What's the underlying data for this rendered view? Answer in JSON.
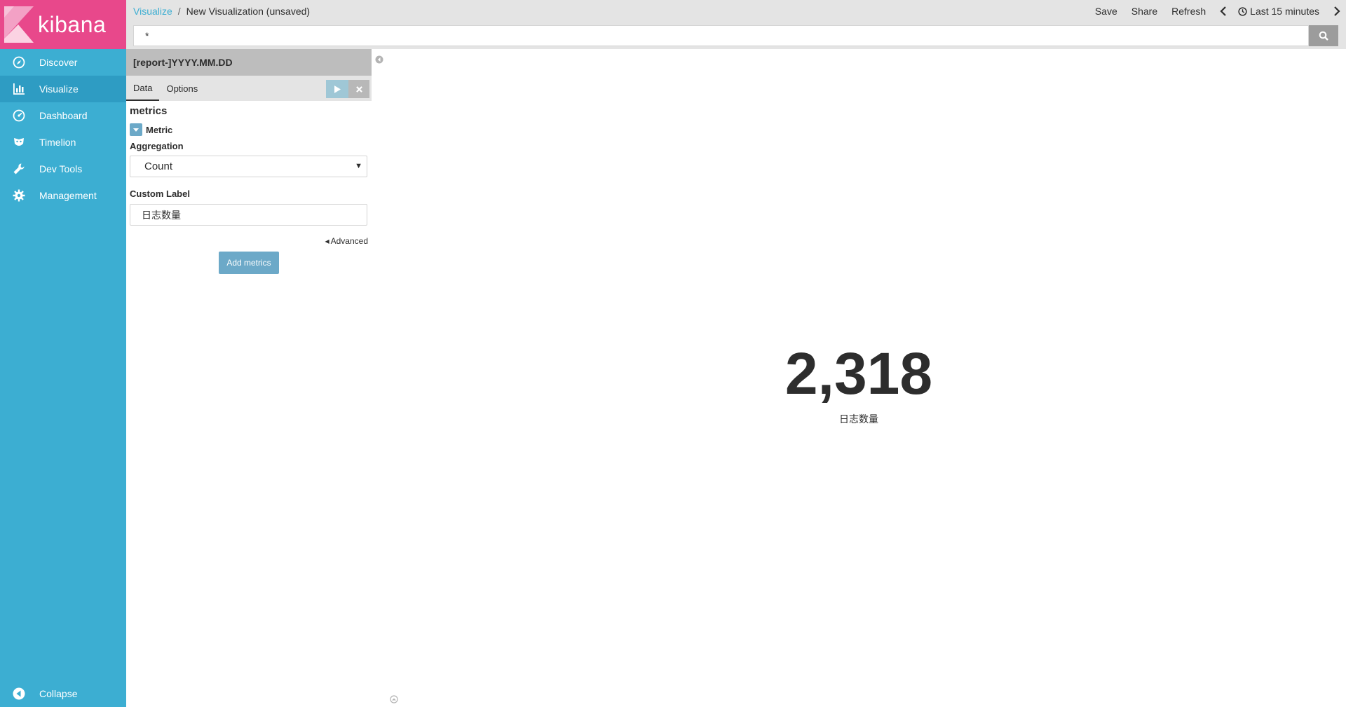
{
  "brand": {
    "name": "kibana",
    "logo_color": "#e8488b",
    "sidebar_color": "#3caed2"
  },
  "sidebar": {
    "items": [
      {
        "label": "Discover",
        "icon": "compass-icon"
      },
      {
        "label": "Visualize",
        "icon": "bar-chart-icon",
        "active": true
      },
      {
        "label": "Dashboard",
        "icon": "dashboard-icon"
      },
      {
        "label": "Timelion",
        "icon": "timelion-icon"
      },
      {
        "label": "Dev Tools",
        "icon": "wrench-icon"
      },
      {
        "label": "Management",
        "icon": "gear-icon"
      }
    ],
    "collapse_label": "Collapse"
  },
  "breadcrumb": {
    "parent": "Visualize",
    "separator": "/",
    "current": "New Visualization (unsaved)"
  },
  "top_actions": {
    "save": "Save",
    "share": "Share",
    "refresh": "Refresh",
    "time_range": "Last 15 minutes"
  },
  "query": {
    "value": "*"
  },
  "editor": {
    "index_pattern": "[report-]YYYY.MM.DD",
    "tabs": [
      "Data",
      "Options"
    ],
    "active_tab": "Data",
    "section_title": "metrics",
    "metric_label": "Metric",
    "aggregation_label": "Aggregation",
    "aggregation_value": "Count",
    "custom_label_label": "Custom Label",
    "custom_label_value": "日志数量",
    "advanced_label": "Advanced",
    "add_metrics_label": "Add metrics"
  },
  "visualization": {
    "value": "2,318",
    "label": "日志数量"
  }
}
